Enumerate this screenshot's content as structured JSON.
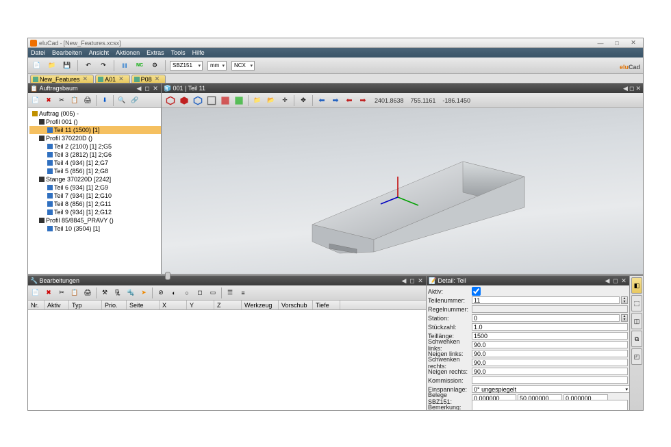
{
  "titlebar": {
    "app": "eluCad",
    "doc": "[New_Features.xcsx]",
    "min": "—",
    "max": "□",
    "close": "✕"
  },
  "menu": [
    "Datei",
    "Bearbeiten",
    "Ansicht",
    "Aktionen",
    "Extras",
    "Tools",
    "Hilfe"
  ],
  "dropdowns": {
    "machine": "SBZ151",
    "unit": "mm",
    "mode": "NCX"
  },
  "tabs": [
    {
      "label": "New_Features",
      "close": "✕"
    },
    {
      "label": "A01",
      "close": "✕"
    },
    {
      "label": "P08",
      "close": "✕"
    }
  ],
  "left_panel": {
    "title": "Auftragsbaum"
  },
  "tree": [
    {
      "lvl": "l1",
      "icon": "folder",
      "label": "Auftrag (005) -"
    },
    {
      "lvl": "l2",
      "icon": "black",
      "label": "Profil 001 ()"
    },
    {
      "lvl": "l3",
      "icon": "blue",
      "label": "Teil 11 (1500) [1]",
      "selected": true
    },
    {
      "lvl": "l2",
      "icon": "black",
      "label": "Profil 370220D ()"
    },
    {
      "lvl": "l3",
      "icon": "blue",
      "label": "Teil 2 (2100) [1]  2;G5"
    },
    {
      "lvl": "l3",
      "icon": "blue",
      "label": "Teil 3 (2812) [1]  2;G6"
    },
    {
      "lvl": "l3",
      "icon": "blue",
      "label": "Teil 4 (934) [1]  2;G7"
    },
    {
      "lvl": "l3",
      "icon": "blue",
      "label": "Teil 5 (856) [1]  2;G8"
    },
    {
      "lvl": "l2",
      "icon": "black",
      "label": "Stange 370220D [2242]"
    },
    {
      "lvl": "l3",
      "icon": "blue",
      "label": "Teil 6 (934) [1]  2;G9"
    },
    {
      "lvl": "l3",
      "icon": "blue",
      "label": "Teil 7 (934) [1]  2;G10"
    },
    {
      "lvl": "l3",
      "icon": "blue",
      "label": "Teil 8 (856) [1]  2;G11"
    },
    {
      "lvl": "l3",
      "icon": "blue",
      "label": "Teil 9 (934) [1]  2;G12"
    },
    {
      "lvl": "l2",
      "icon": "black",
      "label": "Profil 85/8845_PRAVY ()"
    },
    {
      "lvl": "l3",
      "icon": "blue",
      "label": "Teil 10 (3504) [1]"
    }
  ],
  "viewport": {
    "title": "001 | Teil 11",
    "coords": {
      "x": "2401.8638",
      "y": "755.1161",
      "z": "-186.1450"
    }
  },
  "bottom_left": {
    "title": "Bearbeitungen",
    "columns": [
      "Nr.",
      "Aktiv",
      "Typ",
      "Prio.",
      "Seite",
      "X",
      "Y",
      "Z",
      "Werkzeug",
      "Vorschub",
      "Tiefe"
    ]
  },
  "detail": {
    "title": "Detail: Teil",
    "fields": {
      "aktiv_label": "Aktiv:",
      "teilenummer_label": "Teilenummer:",
      "teilenummer": "11",
      "regelnummer_label": "Regelnummer:",
      "regelnummer": "",
      "station_label": "Station:",
      "station": "0",
      "stueckzahl_label": "Stückzahl:",
      "stueckzahl": "1.0",
      "teillaenge_label": "Teillänge:",
      "teillaenge": "1500",
      "schwenkl_label": "Schwenken links:",
      "schwenkl": "90.0",
      "neigenl_label": "Neigen links:",
      "neigenl": "90.0",
      "schwenkr_label": "Schwenken rechts:",
      "schwenkr": "90.0",
      "neigenr_label": "Neigen rechts:",
      "neigenr": "90.0",
      "kommission_label": "Kommission:",
      "kommission": "",
      "einspann_label": "Einspannlage:",
      "einspann": "0° ungespiegelt",
      "belege_label": "Belege SBZ151:",
      "belege1": "0.000000",
      "belege2": "50.000000",
      "belege3": "0.000000",
      "bemerkung_label": "Bemerkung:"
    }
  }
}
